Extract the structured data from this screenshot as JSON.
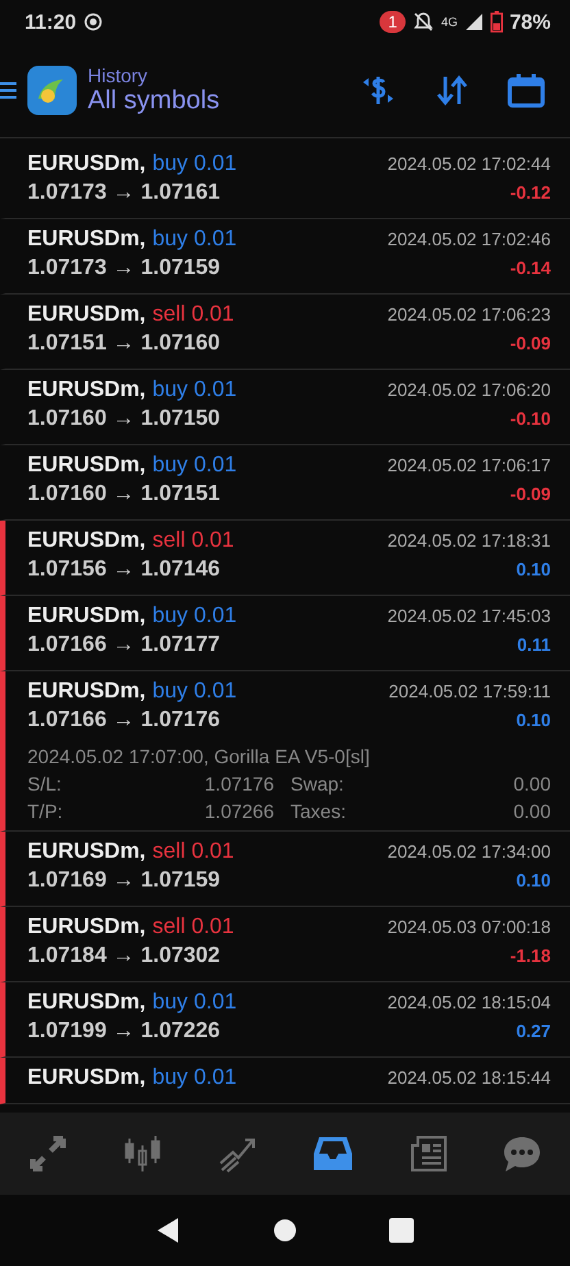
{
  "status_bar": {
    "time": "11:20",
    "notification_count": "1",
    "battery": "78%",
    "network": "4G"
  },
  "header": {
    "subtitle": "History",
    "title": "All symbols"
  },
  "rows": [
    {
      "symbol": "EURUSDm,",
      "type": "buy",
      "volume": "0.01",
      "prices": "1.07173 → 1.07161",
      "time": "2024.05.02 17:02:44",
      "profit": "-0.12",
      "loss": true,
      "marked": false
    },
    {
      "symbol": "EURUSDm,",
      "type": "buy",
      "volume": "0.01",
      "prices": "1.07173 → 1.07159",
      "time": "2024.05.02 17:02:46",
      "profit": "-0.14",
      "loss": true,
      "marked": false
    },
    {
      "symbol": "EURUSDm,",
      "type": "sell",
      "volume": "0.01",
      "prices": "1.07151 → 1.07160",
      "time": "2024.05.02 17:06:23",
      "profit": "-0.09",
      "loss": true,
      "marked": false
    },
    {
      "symbol": "EURUSDm,",
      "type": "buy",
      "volume": "0.01",
      "prices": "1.07160 → 1.07150",
      "time": "2024.05.02 17:06:20",
      "profit": "-0.10",
      "loss": true,
      "marked": false
    },
    {
      "symbol": "EURUSDm,",
      "type": "buy",
      "volume": "0.01",
      "prices": "1.07160 → 1.07151",
      "time": "2024.05.02 17:06:17",
      "profit": "-0.09",
      "loss": true,
      "marked": false
    },
    {
      "symbol": "EURUSDm,",
      "type": "sell",
      "volume": "0.01",
      "prices": "1.07156 → 1.07146",
      "time": "2024.05.02 17:18:31",
      "profit": "0.10",
      "loss": false,
      "marked": true
    },
    {
      "symbol": "EURUSDm,",
      "type": "buy",
      "volume": "0.01",
      "prices": "1.07166 → 1.07177",
      "time": "2024.05.02 17:45:03",
      "profit": "0.11",
      "loss": false,
      "marked": true
    },
    {
      "symbol": "EURUSDm,",
      "type": "buy",
      "volume": "0.01",
      "prices": "1.07166 → 1.07176",
      "time": "2024.05.02 17:59:11",
      "profit": "0.10",
      "loss": false,
      "marked": true,
      "expanded": true,
      "detail": "2024.05.02 17:07:00, Gorilla EA V5-0[sl]",
      "fields": [
        {
          "label": "S/L:",
          "value": "1.07176",
          "label2": "Swap:",
          "value2": "0.00"
        },
        {
          "label": "T/P:",
          "value": "1.07266",
          "label2": "Taxes:",
          "value2": "0.00"
        }
      ]
    },
    {
      "symbol": "EURUSDm,",
      "type": "sell",
      "volume": "0.01",
      "prices": "1.07169 → 1.07159",
      "time": "2024.05.02 17:34:00",
      "profit": "0.10",
      "loss": false,
      "marked": true
    },
    {
      "symbol": "EURUSDm,",
      "type": "sell",
      "volume": "0.01",
      "prices": "1.07184 → 1.07302",
      "time": "2024.05.03 07:00:18",
      "profit": "-1.18",
      "loss": true,
      "marked": true
    },
    {
      "symbol": "EURUSDm,",
      "type": "buy",
      "volume": "0.01",
      "prices": "1.07199 → 1.07226",
      "time": "2024.05.02 18:15:04",
      "profit": "0.27",
      "loss": false,
      "marked": true
    },
    {
      "symbol": "EURUSDm,",
      "type": "buy",
      "volume": "0.01",
      "time": "2024.05.02 18:15:44",
      "marked": true
    }
  ],
  "nav": [
    {
      "kind": "quotes",
      "selected": false
    },
    {
      "kind": "chart",
      "selected": false
    },
    {
      "kind": "trade",
      "selected": false
    },
    {
      "kind": "history",
      "selected": true
    },
    {
      "kind": "news",
      "selected": false
    },
    {
      "kind": "chat",
      "selected": false
    }
  ]
}
